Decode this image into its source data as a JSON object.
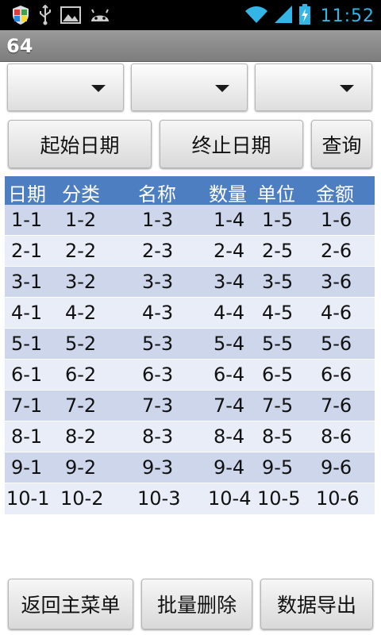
{
  "status_bar": {
    "time": "11:52",
    "icons": [
      "shield-icon",
      "usb-icon",
      "image-icon",
      "android-icon",
      "wifi-icon",
      "signal-icon",
      "battery-charging-icon"
    ]
  },
  "app": {
    "title": "64"
  },
  "filters": {
    "spinner_1": "",
    "spinner_2": "",
    "spinner_3": ""
  },
  "buttons": {
    "start_date": "起始日期",
    "end_date": "终止日期",
    "query": "查询",
    "back_menu": "返回主菜单",
    "batch_delete": "批量删除",
    "export": "数据导出"
  },
  "table": {
    "headers": [
      "日期",
      "分类",
      "名称",
      "数量",
      "单位",
      "金额"
    ],
    "rows": [
      [
        "1-1",
        "1-2",
        "1-3",
        "1-4",
        "1-5",
        "1-6"
      ],
      [
        "2-1",
        "2-2",
        "2-3",
        "2-4",
        "2-5",
        "2-6"
      ],
      [
        "3-1",
        "3-2",
        "3-3",
        "3-4",
        "3-5",
        "3-6"
      ],
      [
        "4-1",
        "4-2",
        "4-3",
        "4-4",
        "4-5",
        "4-6"
      ],
      [
        "5-1",
        "5-2",
        "5-3",
        "5-4",
        "5-5",
        "5-6"
      ],
      [
        "6-1",
        "6-2",
        "6-3",
        "6-4",
        "6-5",
        "6-6"
      ],
      [
        "7-1",
        "7-2",
        "7-3",
        "7-4",
        "7-5",
        "7-6"
      ],
      [
        "8-1",
        "8-2",
        "8-3",
        "8-4",
        "8-5",
        "8-6"
      ],
      [
        "9-1",
        "9-2",
        "9-3",
        "9-4",
        "9-5",
        "9-6"
      ],
      [
        "10-1",
        "10-2",
        "10-3",
        "10-4",
        "10-5",
        "10-6"
      ]
    ]
  },
  "colors": {
    "header_bg": "#4d7ec2",
    "row_odd": "#cdd6ea",
    "row_even": "#e8edf7",
    "time_color": "#33b5e5"
  }
}
